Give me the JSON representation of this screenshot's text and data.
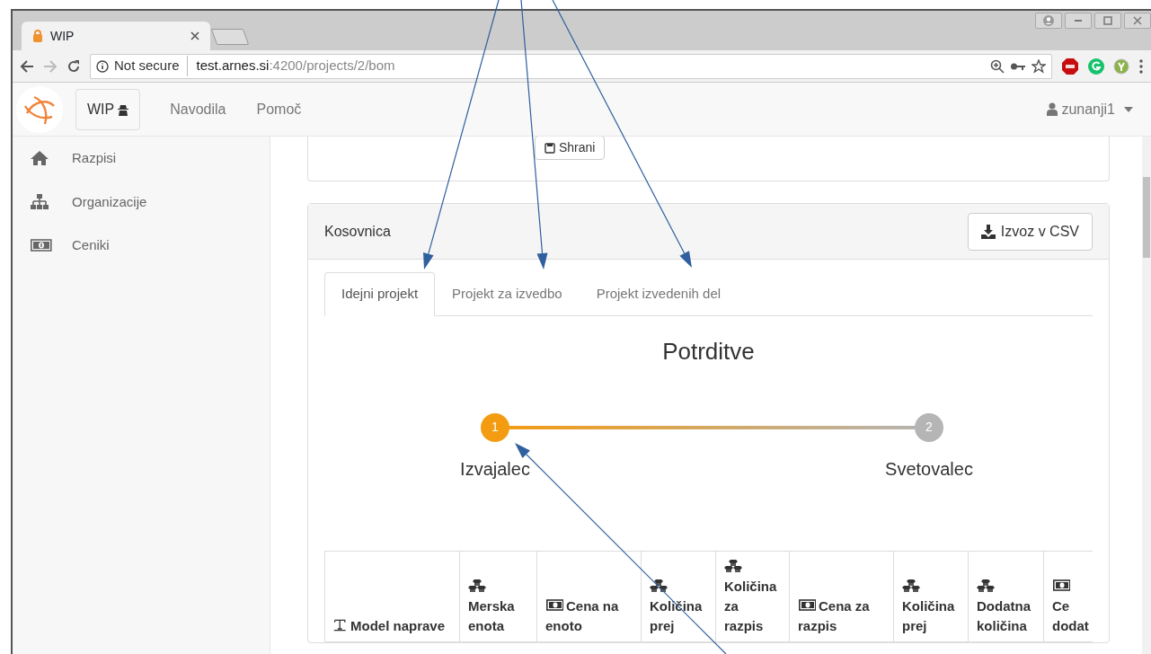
{
  "browser": {
    "tab_title": "WIP",
    "security": "Not secure",
    "url_host": "test.arnes.si",
    "url_path": ":4200/projects/2/bom"
  },
  "navbar": {
    "brand": "WIP",
    "links": [
      "Navodila",
      "Pomoč"
    ],
    "user": "zunanji1"
  },
  "sidebar": {
    "items": [
      {
        "label": "Razpisi"
      },
      {
        "label": "Organizacije"
      },
      {
        "label": "Ceniki"
      }
    ]
  },
  "previous_card": {
    "button": "Shrani"
  },
  "bom_card": {
    "title": "Kosovnica",
    "export_button": "Izvoz v CSV",
    "tabs": [
      {
        "label": "Idejni projekt",
        "selected": true
      },
      {
        "label": "Projekt za izvedbo",
        "selected": false
      },
      {
        "label": "Projekt izvedenih del",
        "selected": false
      }
    ],
    "confirmations": {
      "title": "Potrditve",
      "steps": [
        {
          "number": "1",
          "label": "Izvajalec",
          "done": true
        },
        {
          "number": "2",
          "label": "Svetovalec",
          "done": false
        }
      ]
    },
    "table": {
      "columns": [
        {
          "kind": "text",
          "label": "Model naprave"
        },
        {
          "kind": "quantity",
          "label": "Merska enota"
        },
        {
          "kind": "price",
          "label": "Cena na enoto"
        },
        {
          "kind": "quantity",
          "label": "Količina prej"
        },
        {
          "kind": "quantity",
          "label": "Količina za razpis"
        },
        {
          "kind": "price",
          "label": "Cena za razpis"
        },
        {
          "kind": "quantity",
          "label": "Količina prej"
        },
        {
          "kind": "quantity",
          "label": "Dodatna količina"
        },
        {
          "kind": "price",
          "label": "Ce dodat"
        }
      ]
    }
  }
}
